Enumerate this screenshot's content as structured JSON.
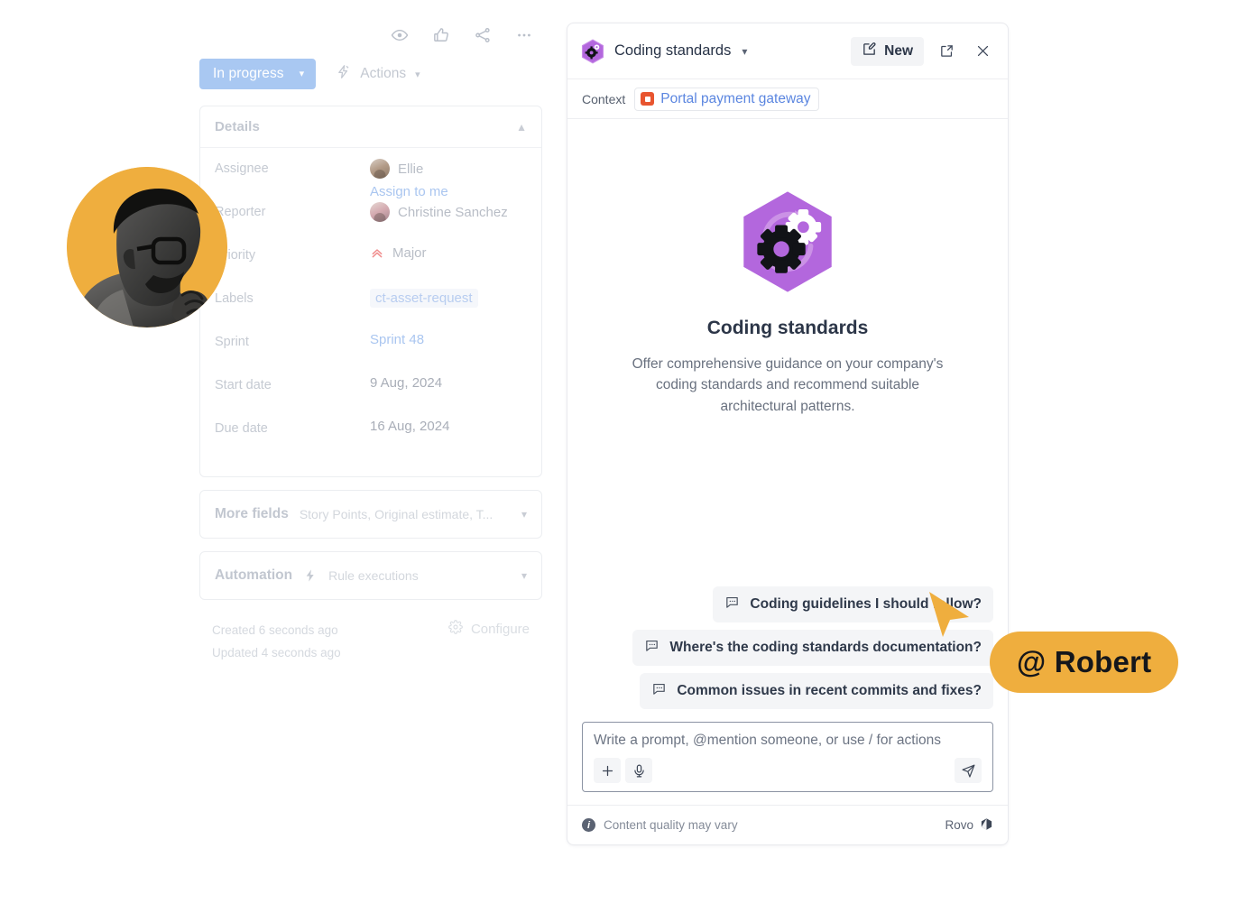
{
  "issue": {
    "top_actions": [
      {
        "name": "watch-icon",
        "label": "Watch"
      },
      {
        "name": "like-icon",
        "label": "Like"
      },
      {
        "name": "share-icon",
        "label": "Share"
      },
      {
        "name": "more-actions-icon",
        "label": "More actions"
      }
    ],
    "status_label": "In progress",
    "status_color": "#a9c8f2",
    "actions_label": "Actions",
    "details": {
      "title": "Details",
      "fields": [
        {
          "label": "Assignee",
          "value": "Ellie",
          "type": "user",
          "sub_link": "Assign to me"
        },
        {
          "label": "Reporter",
          "value": "Christine Sanchez",
          "type": "user"
        },
        {
          "label": "Priority",
          "value": "Major",
          "type": "priority"
        },
        {
          "label": "Labels",
          "value": "ct-asset-request",
          "type": "chip"
        },
        {
          "label": "Sprint",
          "value": "Sprint 48",
          "type": "link"
        },
        {
          "label": "Start date",
          "value": "9 Aug, 2024",
          "type": "text"
        },
        {
          "label": "Due date",
          "value": "16 Aug, 2024",
          "type": "text"
        }
      ]
    },
    "more_fields": {
      "title": "More fields",
      "summary": "Story Points, Original estimate, T..."
    },
    "automation": {
      "title": "Automation",
      "summary": "Rule executions"
    },
    "created_text": "Created 6 seconds ago",
    "updated_text": "Updated 4 seconds ago",
    "configure_label": "Configure"
  },
  "rovo": {
    "title": "Coding standards",
    "new_button_label": "New",
    "context_label": "Context",
    "context_item": "Portal payment gateway",
    "hero": {
      "title": "Coding standards",
      "description": "Offer comprehensive guidance on your company's coding standards and recommend suitable architectural patterns."
    },
    "suggestions": [
      "Coding guidelines I should follow?",
      "Where's the coding standards documentation?",
      "Common issues in recent commits and fixes?"
    ],
    "composer_placeholder": "Write a prompt, @mention someone, or use / for actions",
    "footer_note": "Content quality may vary",
    "footer_brand": "Rovo"
  },
  "overlay": {
    "mention_badge": "@ Robert",
    "badge_color": "#efae3e"
  }
}
